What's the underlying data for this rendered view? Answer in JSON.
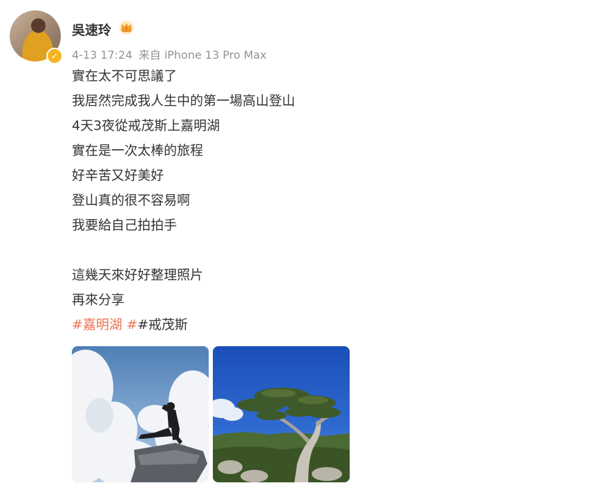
{
  "post": {
    "username": "吳速玲",
    "crown_icon": "crown-icon",
    "verified_icon": "verified-badge-icon",
    "time": "4-13 17:24",
    "source": "来自 iPhone 13 Pro Max",
    "lines": [
      "實在太不可思議了",
      "我居然完成我人生中的第一場高山登山",
      "4天3夜從戒茂斯上嘉明湖",
      "實在是一次太棒的旅程",
      "好辛苦又好美好",
      "登山真的很不容易啊",
      "我要給自己拍拍手"
    ],
    "lines2": [
      "這幾天來好好整理照片",
      "再來分享"
    ],
    "topic1": "#嘉明湖",
    "topic_sep": " #",
    "topic2": "#戒茂斯"
  },
  "colors": {
    "topic": "#eb7350",
    "meta": "#939393",
    "text": "#333333"
  }
}
